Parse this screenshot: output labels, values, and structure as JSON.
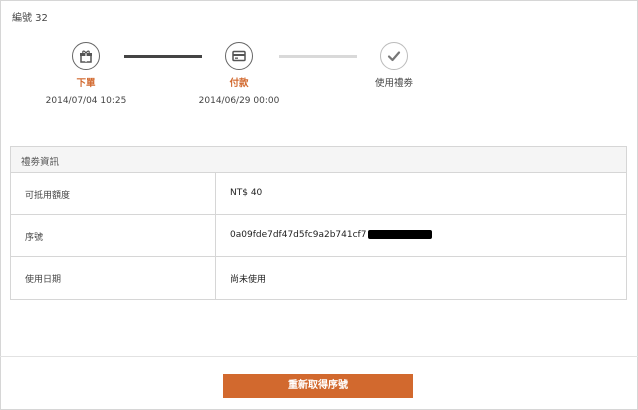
{
  "order": {
    "number_label": "編號 32"
  },
  "steps": [
    {
      "label": "下單",
      "date": "2014/07/04 10:25",
      "icon": "gift-icon",
      "state": "done"
    },
    {
      "label": "付款",
      "date": "2014/06/29 00:00",
      "icon": "credit-card-icon",
      "state": "done"
    },
    {
      "label": "使用禮劵",
      "date": "",
      "icon": "check-icon",
      "state": "pending"
    }
  ],
  "info": {
    "title": "禮劵資訊",
    "rows": [
      {
        "label": "可抵用額度",
        "value": "NT$ 40"
      },
      {
        "label": "序號",
        "value": "0a09fde7df47d5fc9a2b741cf7",
        "redacted": true
      },
      {
        "label": "使用日期",
        "value": "尚未使用"
      }
    ]
  },
  "actions": {
    "regenerate_label": "重新取得序號"
  },
  "colors": {
    "accent": "#d2692e",
    "line_done": "#444444",
    "line_pending": "#d9d9d9",
    "border": "#d6d6d6"
  }
}
